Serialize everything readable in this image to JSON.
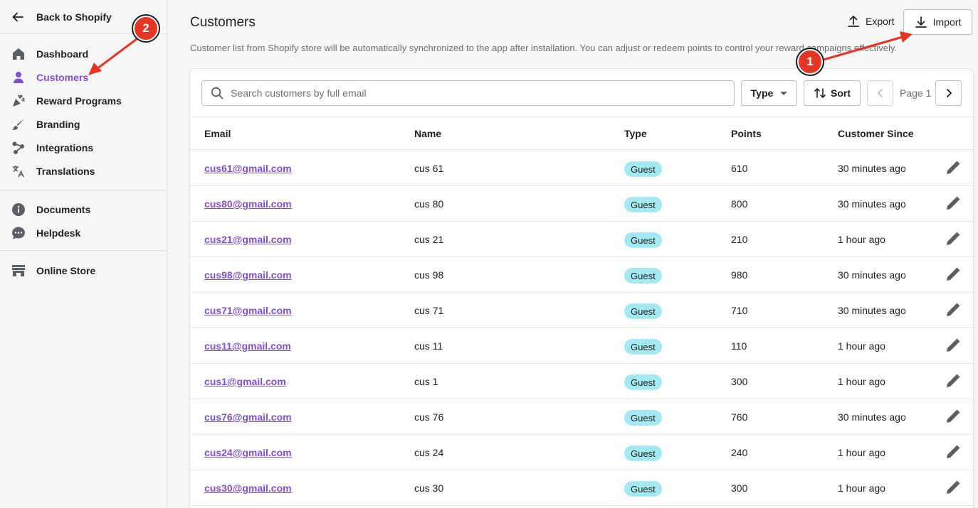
{
  "sidebar": {
    "back_label": "Back to Shopify",
    "group1": [
      {
        "label": "Dashboard",
        "icon": "home-icon"
      },
      {
        "label": "Customers",
        "icon": "person-icon",
        "active": true
      },
      {
        "label": "Reward Programs",
        "icon": "confetti-icon"
      },
      {
        "label": "Branding",
        "icon": "paintbrush-icon"
      },
      {
        "label": "Integrations",
        "icon": "integrations-icon"
      },
      {
        "label": "Translations",
        "icon": "translate-icon"
      }
    ],
    "group2": [
      {
        "label": "Documents",
        "icon": "info-icon"
      },
      {
        "label": "Helpdesk",
        "icon": "chat-icon"
      }
    ],
    "group3": [
      {
        "label": "Online Store",
        "icon": "store-icon"
      }
    ]
  },
  "header": {
    "title": "Customers",
    "subtitle": "Customer list from Shopify store will be automatically synchronized to the app after installation. You can adjust or redeem points to control your reward campaigns effectively.",
    "export_label": "Export",
    "import_label": "Import"
  },
  "toolbar": {
    "search_placeholder": "Search customers by full email",
    "type_label": "Type",
    "sort_label": "Sort",
    "page_label": "Page 1"
  },
  "table": {
    "columns": [
      "Email",
      "Name",
      "Type",
      "Points",
      "Customer Since"
    ],
    "rows": [
      {
        "email": "cus61@gmail.com",
        "name": "cus 61",
        "type": "Guest",
        "points": "610",
        "since": "30 minutes ago"
      },
      {
        "email": "cus80@gmail.com",
        "name": "cus 80",
        "type": "Guest",
        "points": "800",
        "since": "30 minutes ago"
      },
      {
        "email": "cus21@gmail.com",
        "name": "cus 21",
        "type": "Guest",
        "points": "210",
        "since": "1 hour ago"
      },
      {
        "email": "cus98@gmail.com",
        "name": "cus 98",
        "type": "Guest",
        "points": "980",
        "since": "30 minutes ago"
      },
      {
        "email": "cus71@gmail.com",
        "name": "cus 71",
        "type": "Guest",
        "points": "710",
        "since": "30 minutes ago"
      },
      {
        "email": "cus11@gmail.com",
        "name": "cus 11",
        "type": "Guest",
        "points": "110",
        "since": "1 hour ago"
      },
      {
        "email": "cus1@gmail.com",
        "name": "cus 1",
        "type": "Guest",
        "points": "300",
        "since": "1 hour ago"
      },
      {
        "email": "cus76@gmail.com",
        "name": "cus 76",
        "type": "Guest",
        "points": "760",
        "since": "30 minutes ago"
      },
      {
        "email": "cus24@gmail.com",
        "name": "cus 24",
        "type": "Guest",
        "points": "240",
        "since": "1 hour ago"
      },
      {
        "email": "cus30@gmail.com",
        "name": "cus 30",
        "type": "Guest",
        "points": "300",
        "since": "1 hour ago"
      }
    ]
  },
  "annotations": {
    "step1": "1",
    "step2": "2"
  },
  "colors": {
    "accent": "#8051ce",
    "badge": "#a4e8f2",
    "annotation": "#e53525"
  }
}
